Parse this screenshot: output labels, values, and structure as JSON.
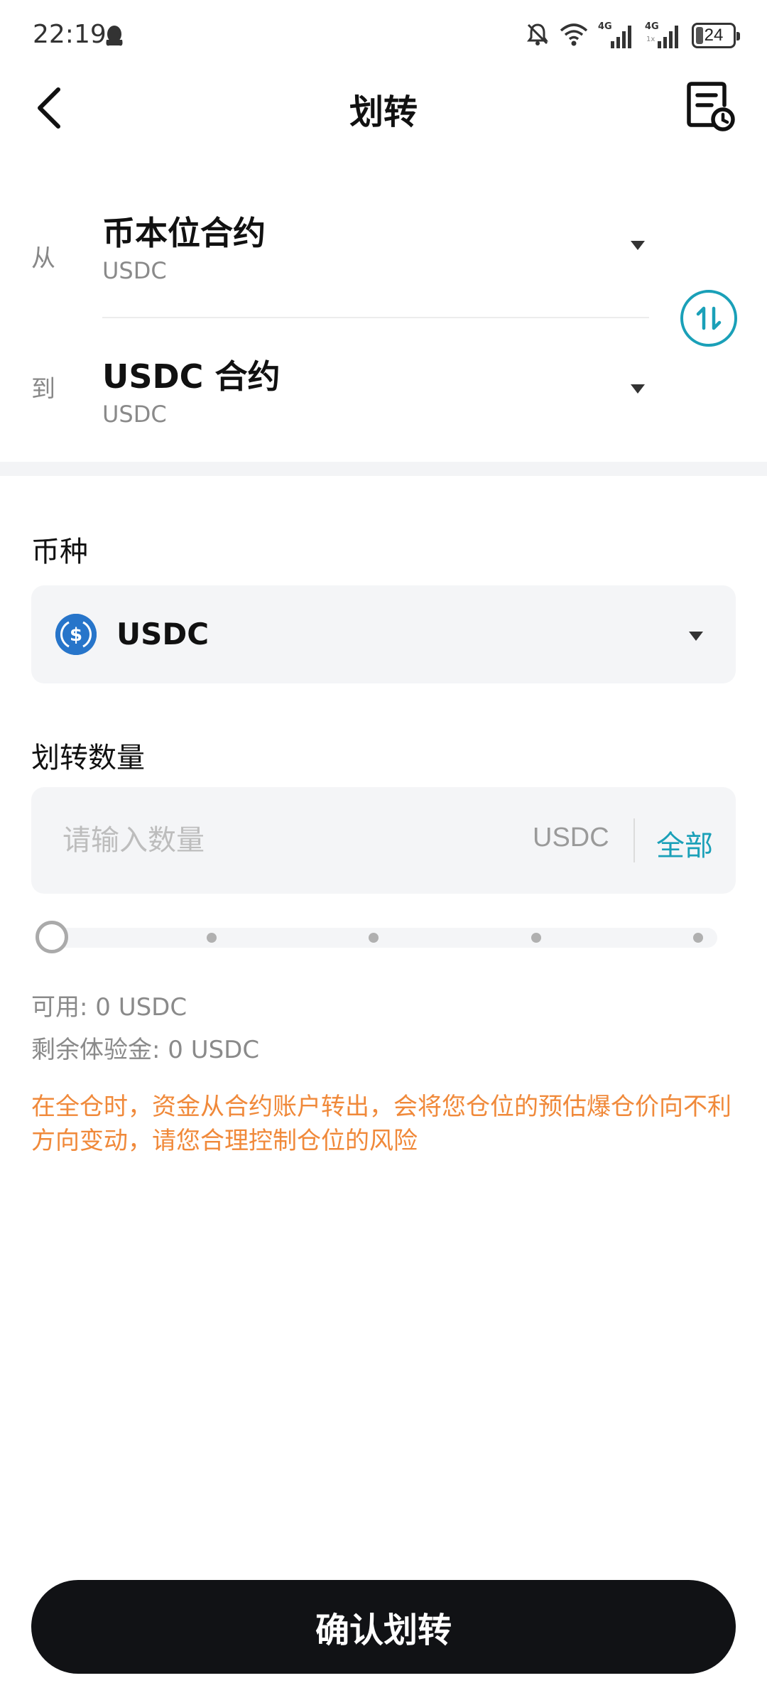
{
  "status_bar": {
    "time": "22:19",
    "signal1_label": "4G",
    "signal2_label": "4G",
    "signal2_sub": "1x",
    "battery": "24"
  },
  "header": {
    "title": "划转"
  },
  "transfer": {
    "from": {
      "label": "从",
      "account": "币本位合约",
      "currency": "USDC"
    },
    "to": {
      "label": "到",
      "account": "USDC 合约",
      "currency": "USDC"
    }
  },
  "currency_field": {
    "label": "币种",
    "selected": "USDC"
  },
  "amount_field": {
    "label": "划转数量",
    "placeholder": "请输入数量",
    "value": "",
    "unit": "USDC",
    "max_label": "全部"
  },
  "slider": {
    "value_percent": 0,
    "stops": 5
  },
  "balance": {
    "available": "可用: 0 USDC",
    "trial_fund": "剩余体验金: 0 USDC"
  },
  "warning": "在全仓时，资金从合约账户转出，会将您仓位的预估爆仓价向不利方向变动，请您合理控制仓位的风险",
  "confirm_button": "确认划转",
  "colors": {
    "accent": "#1aa0b8",
    "warning": "#f0893a",
    "button_bg": "#111215",
    "usdc_blue": "#2775ca"
  }
}
